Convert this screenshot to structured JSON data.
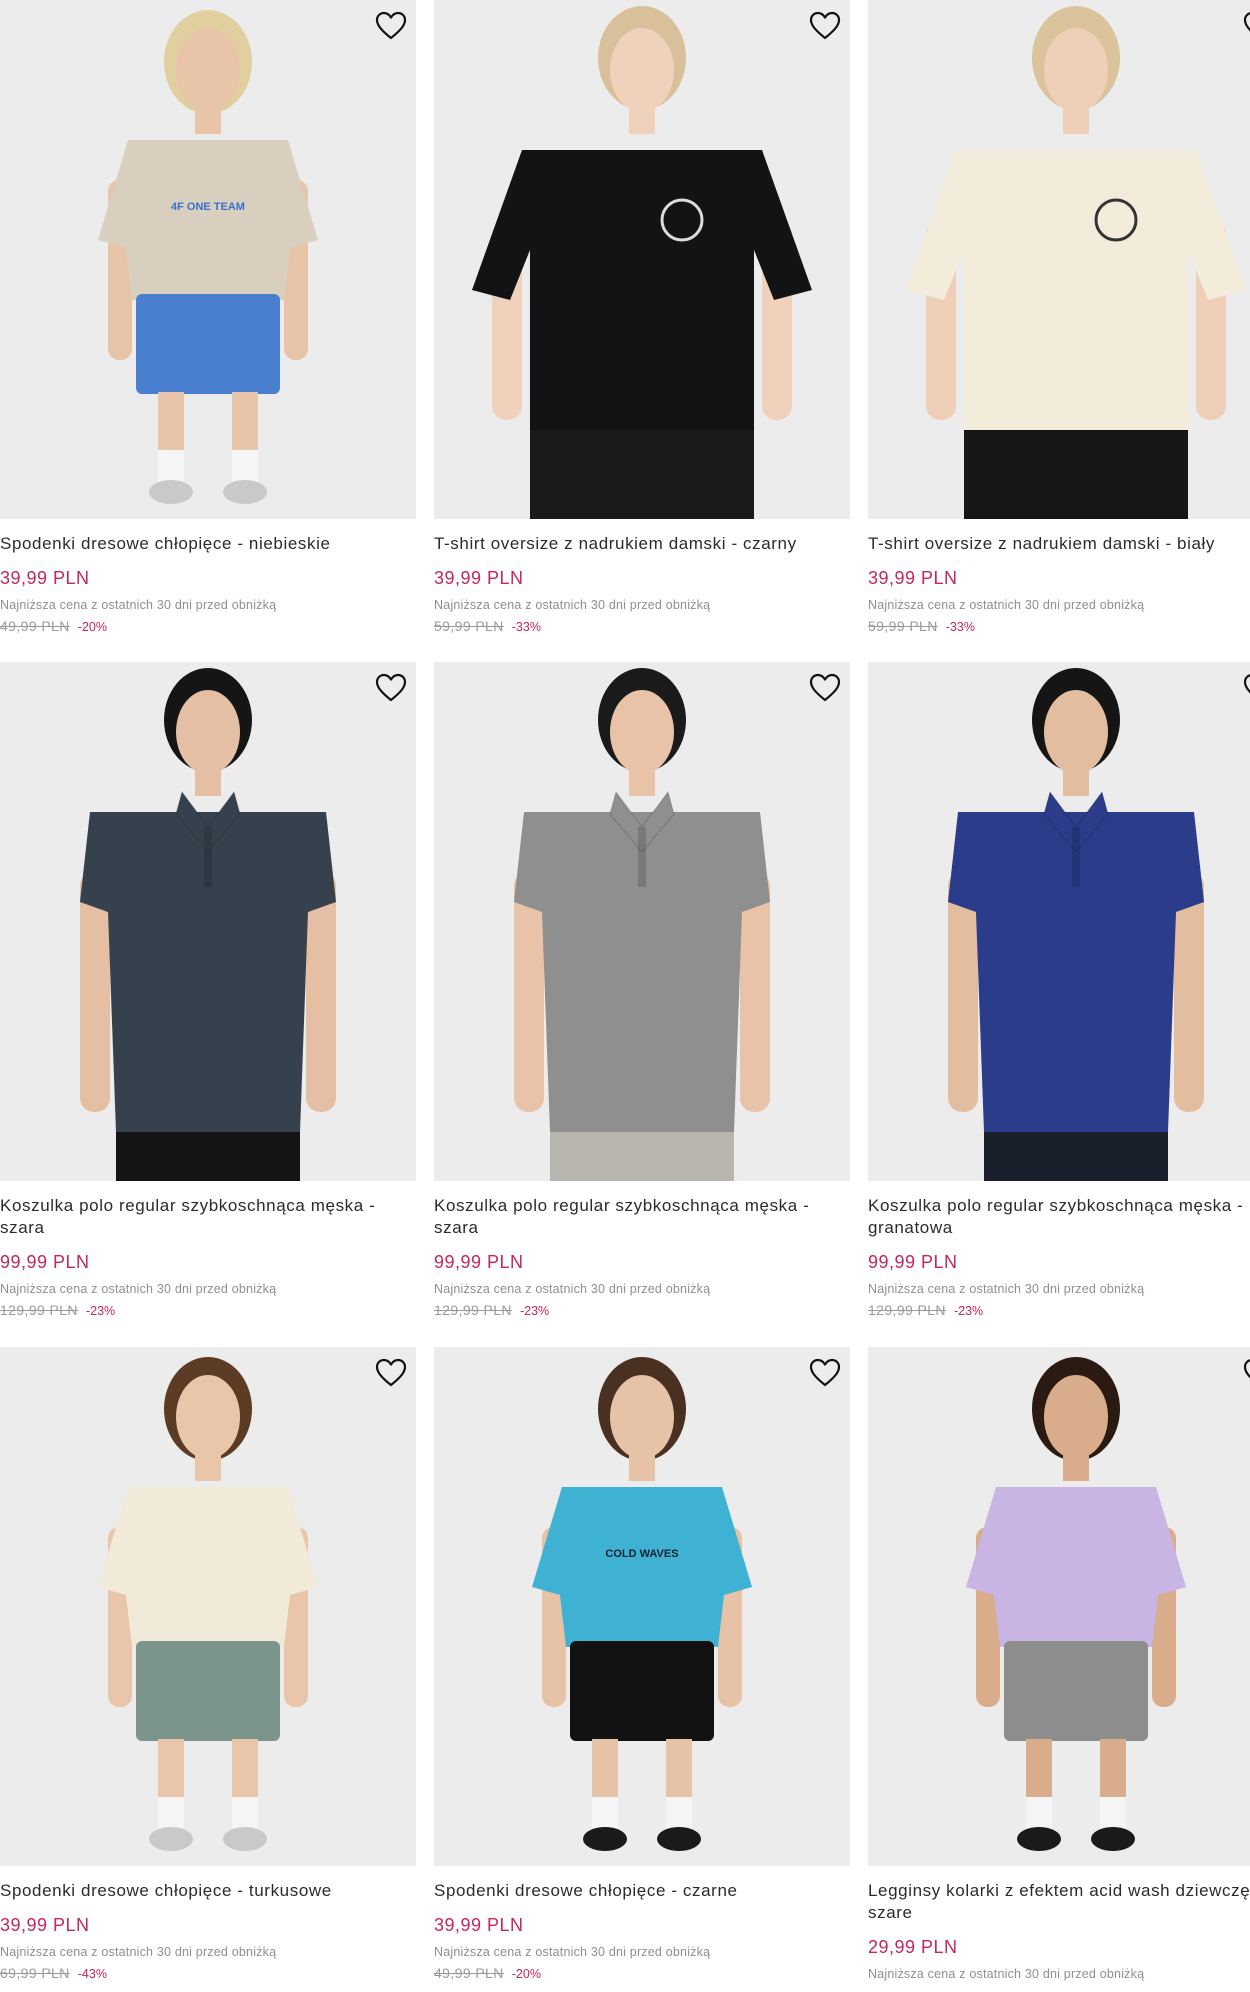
{
  "ui": {
    "lowest_price_note": "Najniższa cena z ostatnich 30 dni przed obniżką",
    "wishlist_icon": "heart-outline-icon"
  },
  "products": [
    {
      "name": "Spodenki dresowe chłopięce - niebieskie",
      "price": "39,99 PLN",
      "old_price": "49,99 PLN",
      "discount": "-20%",
      "print_text": "4F ONE TEAM",
      "colors": {
        "bg": "#ececec",
        "top": "#d9cfbe",
        "bottom": "#4a7fd0",
        "skin": "#e8c4a8",
        "hair": "#e2cfa0",
        "shoe": "#c9c9c9"
      }
    },
    {
      "name": "T-shirt oversize z nadrukiem damski - czarny",
      "price": "39,99 PLN",
      "old_price": "59,99 PLN",
      "discount": "-33%",
      "colors": {
        "bg": "#ececec",
        "top": "#121315",
        "bottom": "#1a1a1a",
        "skin": "#f0d2bc",
        "hair": "#d8c09a"
      }
    },
    {
      "name": "T-shirt oversize z nadrukiem damski - biały",
      "price": "39,99 PLN",
      "old_price": "59,99 PLN",
      "discount": "-33%",
      "colors": {
        "bg": "#ececec",
        "top": "#f3ecdb",
        "bottom": "#161616",
        "skin": "#efcfb8",
        "hair": "#dbc49b"
      }
    },
    {
      "name": "Koszulka polo regular szybkoschnąca męska - szara",
      "price": "99,99 PLN",
      "old_price": "129,99 PLN",
      "discount": "-23%",
      "colors": {
        "bg": "#ececec",
        "top": "#35424d",
        "bottom": "#141414",
        "skin": "#e5bfa3",
        "hair": "#151515"
      }
    },
    {
      "name": "Koszulka polo regular szybkoschnąca męska - szara",
      "price": "99,99 PLN",
      "old_price": "129,99 PLN",
      "discount": "-23%",
      "colors": {
        "bg": "#ececec",
        "top": "#8f8f8f",
        "bottom": "#b9b6b0",
        "skin": "#e8c3a7",
        "hair": "#1a1a1a"
      }
    },
    {
      "name": "Koszulka polo regular szybkoschnąca męska - granatowa",
      "price": "99,99 PLN",
      "old_price": "129,99 PLN",
      "discount": "-23%",
      "colors": {
        "bg": "#ececec",
        "top": "#2b3d8a",
        "bottom": "#1a1f2c",
        "skin": "#e3bd9f",
        "hair": "#151515"
      }
    },
    {
      "name": "Spodenki dresowe chłopięce - turkusowe",
      "price": "39,99 PLN",
      "old_price": "69,99 PLN",
      "discount": "-43%",
      "colors": {
        "bg": "#ececec",
        "top": "#f1ead9",
        "bottom": "#7b958c",
        "skin": "#e9c6aa",
        "hair": "#5b3b23",
        "shoe": "#c9c9c9"
      }
    },
    {
      "name": "Spodenki dresowe chłopięce - czarne",
      "price": "39,99 PLN",
      "old_price": "49,99 PLN",
      "discount": "-20%",
      "print_text": "COLD WAVES",
      "colors": {
        "bg": "#ececec",
        "top": "#3fb1d3",
        "bottom": "#121212",
        "skin": "#e6c2a6",
        "hair": "#4a3020",
        "shoe": "#1a1a1a"
      }
    },
    {
      "name": "Legginsy kolarki z efektem acid wash dziewczęce - szare",
      "price": "29,99 PLN",
      "old_price": "",
      "discount": "",
      "colors": {
        "bg": "#ececec",
        "top": "#c9b5e3",
        "bottom": "#8d8d8d",
        "skin": "#d9ad8c",
        "hair": "#2a1a12",
        "shoe": "#1a1a1a"
      }
    }
  ]
}
